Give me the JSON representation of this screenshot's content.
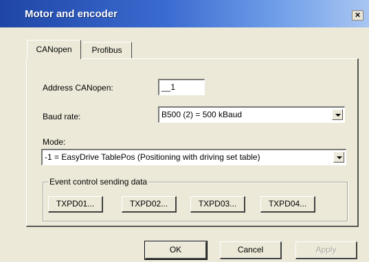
{
  "window": {
    "title": "Motor and encoder",
    "close_label": "×"
  },
  "tabs": [
    {
      "label": "CANopen",
      "active": true
    },
    {
      "label": "Profibus",
      "active": false
    }
  ],
  "canopen": {
    "address_label": "Address CANopen:",
    "address_value": "__1",
    "baud_label": "Baud rate:",
    "baud_value": "B500 (2) = 500 kBaud",
    "mode_label": "Mode:",
    "mode_value": "-1 = EasyDrive TablePos (Positioning with driving set table)",
    "event_group_label": "Event control sending data",
    "txpdo_buttons": [
      "TXPD01...",
      "TXPD02...",
      "TXPD03...",
      "TXPD04..."
    ]
  },
  "footer": {
    "ok_label": "OK",
    "cancel_label": "Cancel",
    "apply_label": "Apply"
  },
  "colors": {
    "title_start": "#1f46a6",
    "title_end": "#a9c6f2",
    "dialog_bg": "#ece9d8"
  }
}
